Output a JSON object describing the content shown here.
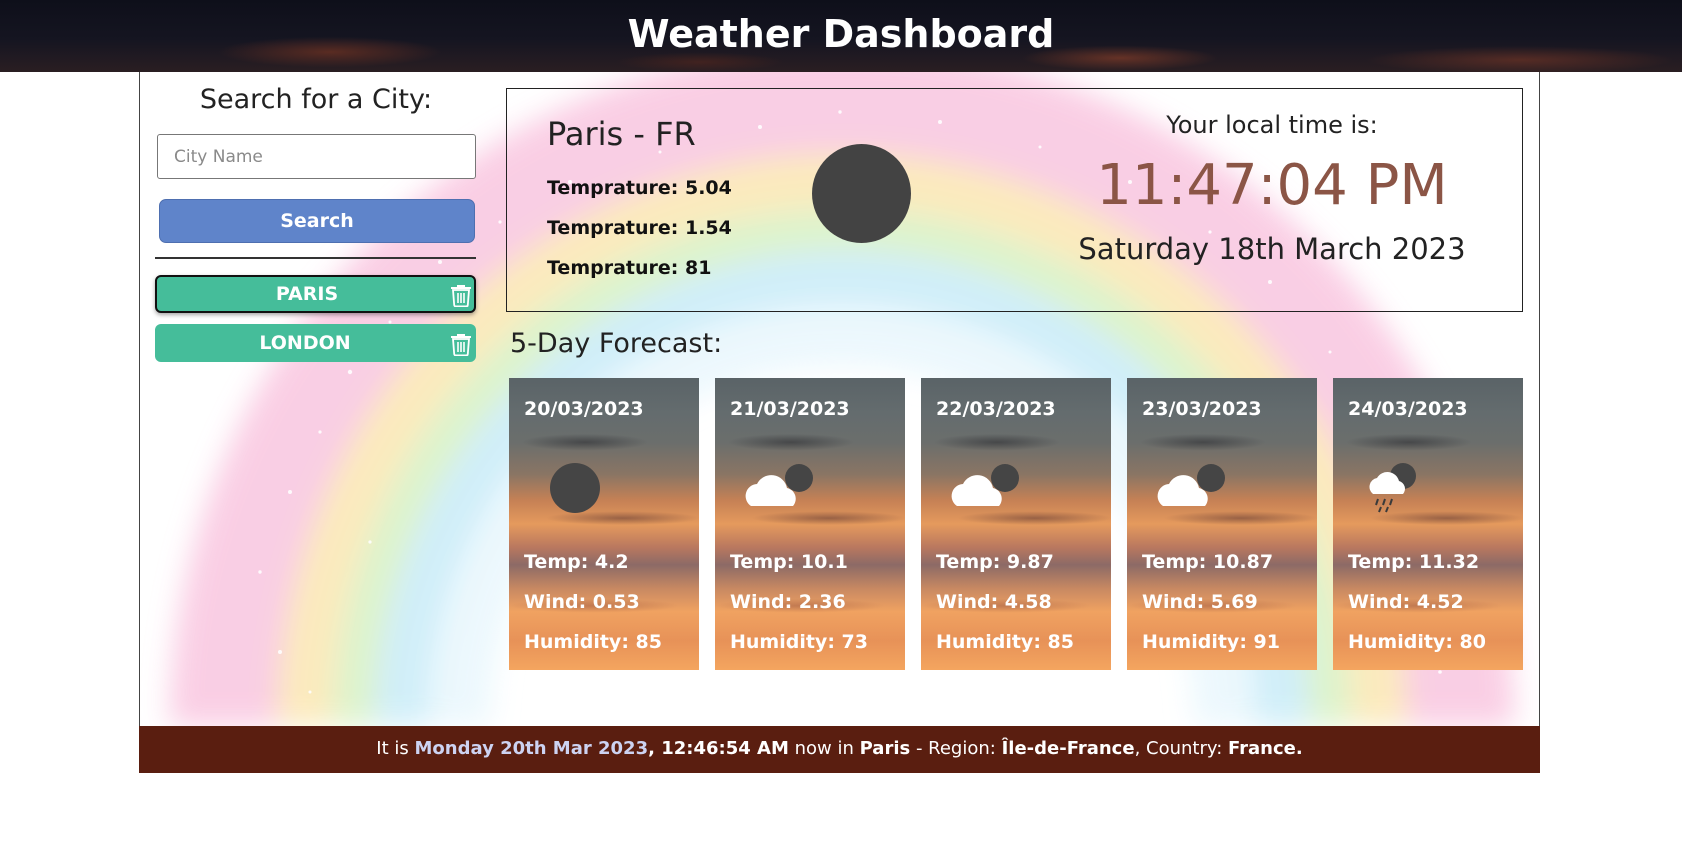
{
  "header": {
    "title": "Weather Dashboard"
  },
  "sidebar": {
    "heading": "Search for a City:",
    "input_placeholder": "City Name",
    "search_label": "Search",
    "cities": [
      {
        "label": "PARIS",
        "active": true,
        "icon": "trash-icon"
      },
      {
        "label": "LONDON",
        "active": false,
        "icon": "trash-icon"
      }
    ]
  },
  "current": {
    "city": "Paris - FR",
    "stats": [
      "Temprature: 5.04",
      "Temprature: 1.54",
      "Temprature: 81"
    ],
    "icon": "moon-icon",
    "local_label": "Your local time is:",
    "clock": "11:47:04 PM",
    "date": "Saturday 18th March 2023",
    "clock_color": "#8b5546"
  },
  "forecast": {
    "heading": "5-Day Forecast:",
    "days": [
      {
        "date": "20/03/2023",
        "icon": "moon-icon",
        "temp": "Temp: 4.2",
        "wind": "Wind: 0.53",
        "humidity": "Humidity: 85"
      },
      {
        "date": "21/03/2023",
        "icon": "cloud-night-icon",
        "temp": "Temp: 10.1",
        "wind": "Wind: 2.36",
        "humidity": "Humidity: 73"
      },
      {
        "date": "22/03/2023",
        "icon": "cloud-night-icon",
        "temp": "Temp: 9.87",
        "wind": "Wind: 4.58",
        "humidity": "Humidity: 85"
      },
      {
        "date": "23/03/2023",
        "icon": "cloud-night-icon",
        "temp": "Temp: 10.87",
        "wind": "Wind: 5.69",
        "humidity": "Humidity: 91"
      },
      {
        "date": "24/03/2023",
        "icon": "rain-cloud-night-icon",
        "temp": "Temp: 11.32",
        "wind": "Wind: 4.52",
        "humidity": "Humidity: 80"
      }
    ]
  },
  "footer": {
    "prefix": "It is ",
    "datetime": "Monday 20th Mar 2023",
    "comma": ", ",
    "time": "12:46:54 AM",
    "now_in": " now in ",
    "city": "Paris",
    "region_label": " - Region: ",
    "region": "Île-de-France",
    "country_label": ", Country: ",
    "country": "France."
  },
  "colors": {
    "search_button": "#5f84ca",
    "city_button": "#45bd9a",
    "footer_bg": "#5a1e10",
    "footer_highlight": "#cdd3f2"
  }
}
